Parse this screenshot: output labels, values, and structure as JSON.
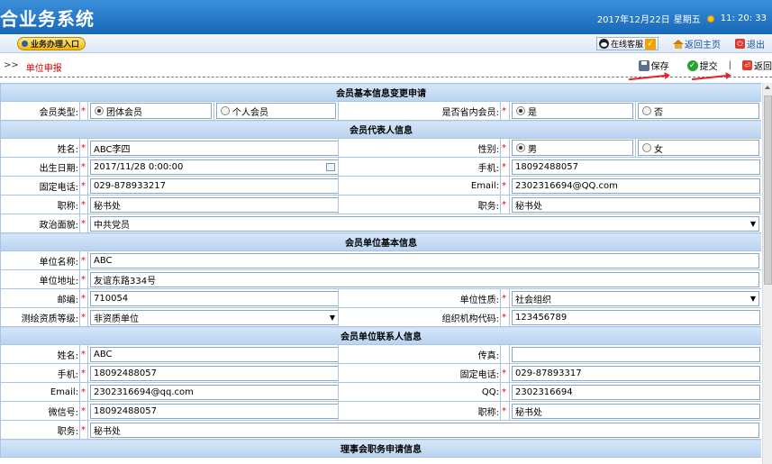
{
  "header": {
    "app_title": "合业务系统",
    "date": "2017年12月22日",
    "weekday": "星期五",
    "time": "11: 20: 33"
  },
  "navbar": {
    "biz_entry": "业务办理入口",
    "online_service": "在线客服",
    "home": "返回主页",
    "logout": "退出"
  },
  "toolbar": {
    "crumb_arrow": ">>",
    "crumb": "单位申报",
    "save": "保存",
    "submit": "提交",
    "separator": "|",
    "back": "返回"
  },
  "colors": {
    "header_blue": "#1768b8",
    "section_bg": "#c6dcf3",
    "required_star": "#e00000",
    "breadcrumb_red": "#d20000",
    "annotation_arrow": "#e8222a"
  },
  "form": {
    "sections": {
      "change_request": "会员基本信息变更申请",
      "representative": "会员代表人信息",
      "unit_basic": "会员单位基本信息",
      "unit_contact": "会员单位联系人信息",
      "council": "理事会职务申请信息"
    },
    "star": "*",
    "member_type": {
      "label": "会员类型:",
      "opt1": "团体会员",
      "opt2": "个人会员",
      "selected": "团体会员"
    },
    "in_province": {
      "label": "是否省内会员:",
      "opt1": "是",
      "opt2": "否",
      "selected": "是"
    },
    "rep": {
      "name_label": "姓名:",
      "name": "ABC李四",
      "gender_label": "性别:",
      "gender_opt1": "男",
      "gender_opt2": "女",
      "gender_selected": "男",
      "birth_label": "出生日期:",
      "birth": "2017/11/28 0:00:00",
      "mobile_label": "手机:",
      "mobile": "18092488057",
      "phone_label": "固定电话:",
      "phone": "029-878933217",
      "email_label": "Email:",
      "email": "2302316694@QQ.com",
      "title_label": "职称:",
      "title": "秘书处",
      "position_label": "职务:",
      "position": "秘书处",
      "politics_label": "政治面貌:",
      "politics": "中共党员"
    },
    "unit": {
      "name_label": "单位名称:",
      "name": "ABC",
      "address_label": "单位地址:",
      "address": "友谊东路334号",
      "zip_label": "邮编:",
      "zip": "710054",
      "nature_label": "单位性质:",
      "nature": "社会组织",
      "qual_label": "测绘资质等级:",
      "qual": "非资质单位",
      "org_code_label": "组织机构代码:",
      "org_code": "123456789"
    },
    "contact": {
      "name_label": "姓名:",
      "name": "ABC",
      "fax_label": "传真:",
      "fax": "",
      "mobile_label": "手机:",
      "mobile": "18092488057",
      "phone_label": "固定电话:",
      "phone": "029-87893317",
      "email_label": "Email:",
      "email": "2302316694@qq.com",
      "qq_label": "QQ:",
      "qq": "2302316694",
      "wechat_label": "微信号:",
      "wechat": "18092488057",
      "title_label": "职称:",
      "title": "秘书处",
      "position_label": "职务:",
      "position": "秘书处"
    }
  }
}
